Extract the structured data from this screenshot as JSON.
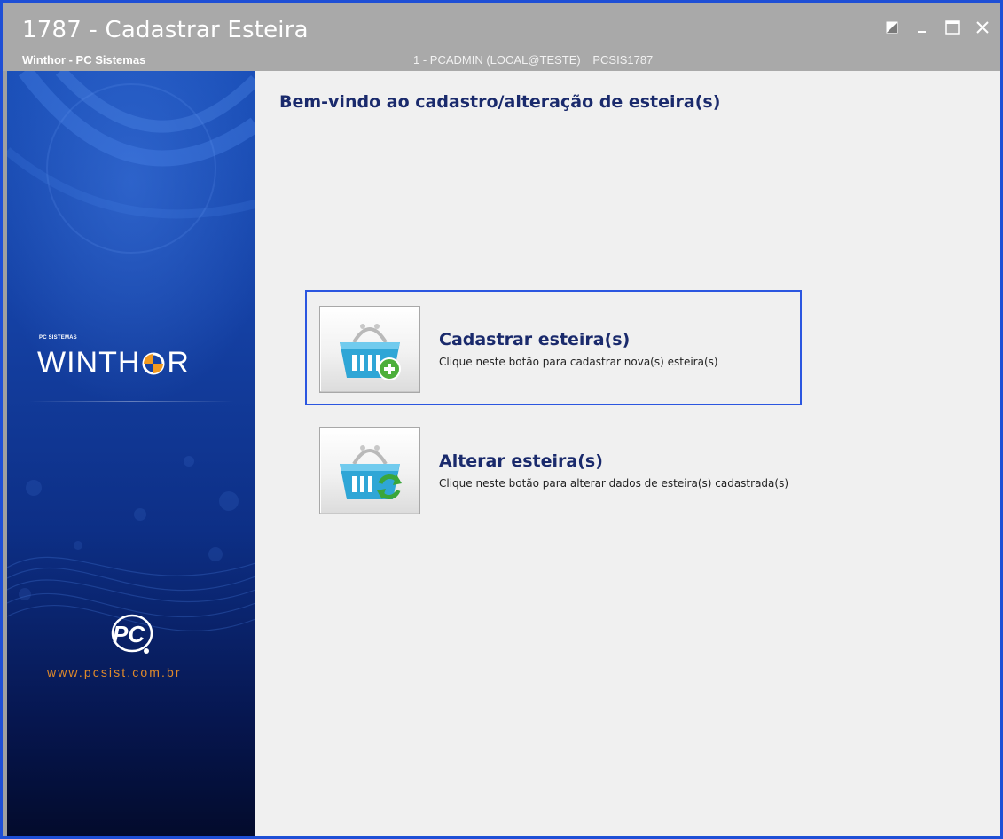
{
  "window": {
    "title": "1787 - Cadastrar Esteira",
    "subtitle": "Winthor - PC Sistemas",
    "user": "1 - PCADMIN (LOCAL@TESTE)",
    "routine": "PCSIS1787",
    "controls": [
      "restore-icon",
      "minimize-icon",
      "maximize-icon",
      "close-icon"
    ]
  },
  "sidebar": {
    "brand_small": "PC SISTEMAS",
    "brand_logo_left": "WINTH",
    "brand_logo_right": "R",
    "website": "www.pcsist.com.br",
    "logo_text": "PC"
  },
  "main": {
    "welcome": "Bem-vindo ao cadastro/alteração de esteira(s)",
    "actions": [
      {
        "title": "Cadastrar esteira(s)",
        "description": "Clique neste botão para cadastrar nova(s) esteira(s)",
        "icon": "basket-add-icon",
        "focused": true
      },
      {
        "title": "Alterar esteira(s)",
        "description": "Clique neste botão para alterar dados de esteira(s) cadastrada(s)",
        "icon": "basket-refresh-icon",
        "focused": false
      }
    ]
  },
  "colors": {
    "accent": "#2b56e0",
    "heading": "#1a2a6c",
    "titlebar": "#a9a9a9",
    "website": "#e08a2a"
  }
}
